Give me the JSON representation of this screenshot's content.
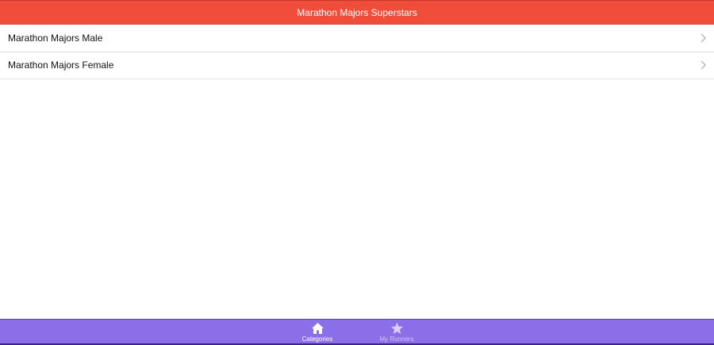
{
  "header": {
    "title": "Marathon Majors Superstars",
    "background_color": "#f04e3b"
  },
  "list": {
    "items": [
      {
        "label": "Marathon Majors Male",
        "icon": "chevron-right-icon"
      },
      {
        "label": "Marathon Majors Female",
        "icon": "chevron-right-icon"
      }
    ]
  },
  "tabbar": {
    "background_color": "#8b6fe8",
    "tabs": [
      {
        "label": "Categories",
        "icon": "home-icon",
        "active": true
      },
      {
        "label": "My Runners",
        "icon": "star-icon",
        "active": false
      }
    ]
  }
}
